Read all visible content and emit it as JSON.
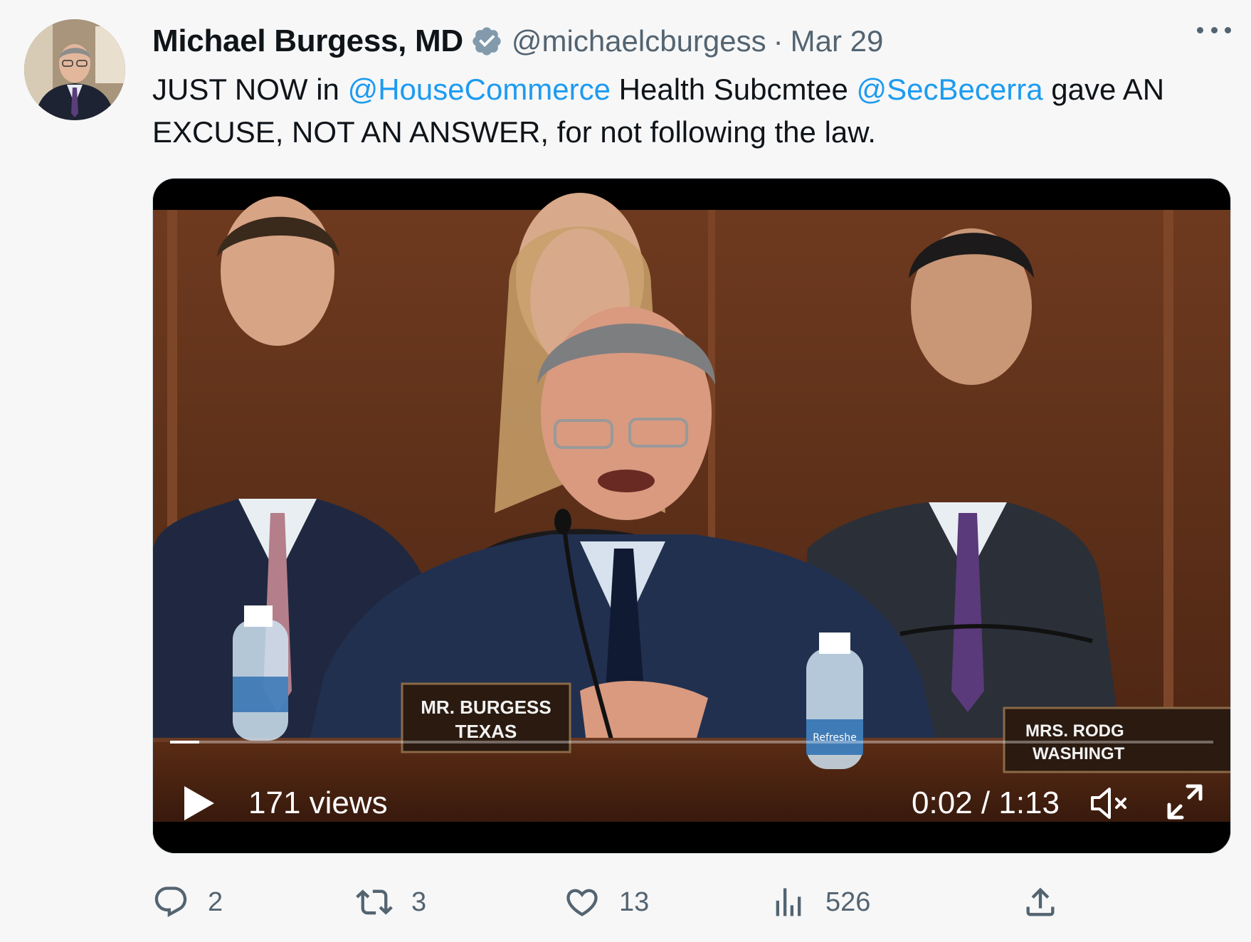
{
  "author": {
    "name": "Michael Burgess, MD",
    "handle": "@michaelcburgess",
    "separator": "·",
    "date": "Mar 29",
    "verified": true
  },
  "tweet": {
    "text_parts": [
      {
        "text": "JUST NOW in ",
        "mention": false
      },
      {
        "text": "@HouseCommerce",
        "mention": true
      },
      {
        "text": " Health Subcmtee ",
        "mention": false
      },
      {
        "text": "@SecBecerra",
        "mention": true
      },
      {
        "text": " gave AN EXCUSE, NOT AN ANSWER, for not following the law.",
        "mention": false
      }
    ]
  },
  "video": {
    "views": "171 views",
    "time": "0:02 / 1:13",
    "progress_fraction": 0.028,
    "nameplates": {
      "center_line1": "MR. BURGESS",
      "center_line2": "TEXAS",
      "right_line1": "MRS. RODG",
      "right_line2": "WASHINGT"
    },
    "bottle_label": "Refreshe"
  },
  "actions": {
    "replies": "2",
    "retweets": "3",
    "likes": "13",
    "views": "526"
  },
  "colors": {
    "link": "#1d9bf0",
    "secondary_text": "#536471",
    "verified_badge": "#829aab"
  },
  "icons": [
    "verified-badge-icon",
    "more-icon",
    "play-icon",
    "mute-icon",
    "fullscreen-icon",
    "reply-icon",
    "retweet-icon",
    "like-icon",
    "views-icon",
    "share-icon"
  ]
}
